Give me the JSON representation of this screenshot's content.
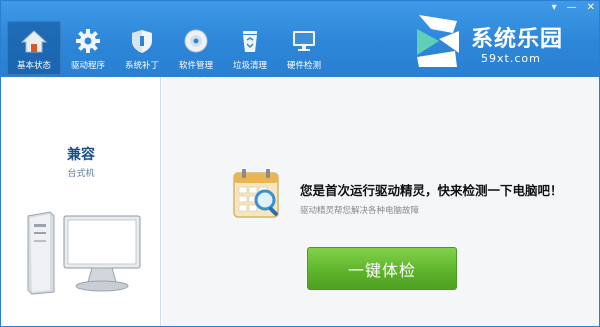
{
  "topbar": {
    "window_controls": [
      "▾",
      "—",
      "✕"
    ],
    "nav": [
      {
        "label": "基本状态",
        "icon": "home-icon",
        "active": true
      },
      {
        "label": "驱动程序",
        "icon": "gear-icon",
        "active": false
      },
      {
        "label": "系统补丁",
        "icon": "shield-icon",
        "active": false
      },
      {
        "label": "软件管理",
        "icon": "disc-icon",
        "active": false
      },
      {
        "label": "垃圾清理",
        "icon": "recycle-bin-icon",
        "active": false
      },
      {
        "label": "硬件检测",
        "icon": "monitor-icon",
        "active": false
      }
    ]
  },
  "logo": {
    "title": "系统乐园",
    "url": "59xt.com"
  },
  "device": {
    "title": "兼容",
    "subtitle": "台式机",
    "icon": "desktop-computer-icon"
  },
  "main": {
    "icon": "calendar-search-icon",
    "headline": "您是首次运行驱动精灵，快来检测一下电脑吧！",
    "subline": "驱动精灵帮您解决各种电脑故障",
    "button_label": "一键体检"
  },
  "colors": {
    "topbar": "#2d86d8",
    "button": "#5eb52c",
    "device_title": "#1b4f85"
  }
}
